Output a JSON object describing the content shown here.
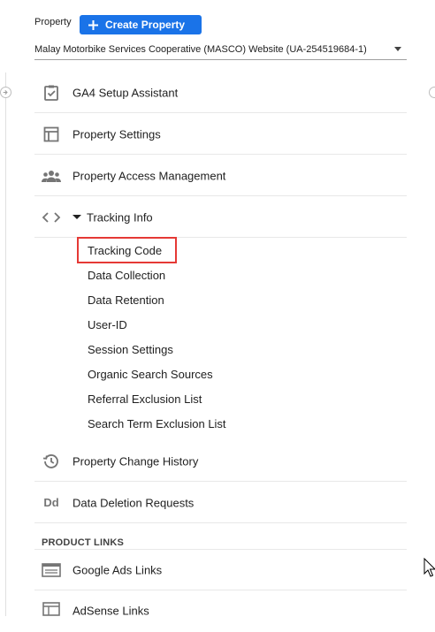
{
  "header": {
    "property_label": "Property",
    "create_button_label": "Create Property",
    "property_select_value": "Malay Motorbike Services Cooperative (MASCO) Website (UA-254519684-1)"
  },
  "nav": {
    "ga4_setup": "GA4 Setup Assistant",
    "property_settings": "Property Settings",
    "property_access": "Property Access Management",
    "tracking_info": "Tracking Info",
    "tracking_sub": [
      "Tracking Code",
      "Data Collection",
      "Data Retention",
      "User-ID",
      "Session Settings",
      "Organic Search Sources",
      "Referral Exclusion List",
      "Search Term Exclusion List"
    ],
    "change_history": "Property Change History",
    "data_deletion": "Data Deletion Requests",
    "data_deletion_icon_text": "Dd",
    "product_links_header": "PRODUCT LINKS",
    "google_ads_links": "Google Ads Links",
    "adsense_links": "AdSense Links"
  },
  "colors": {
    "accent": "#1a73e8",
    "highlight": "#e53935",
    "icon_gray": "#757575"
  }
}
